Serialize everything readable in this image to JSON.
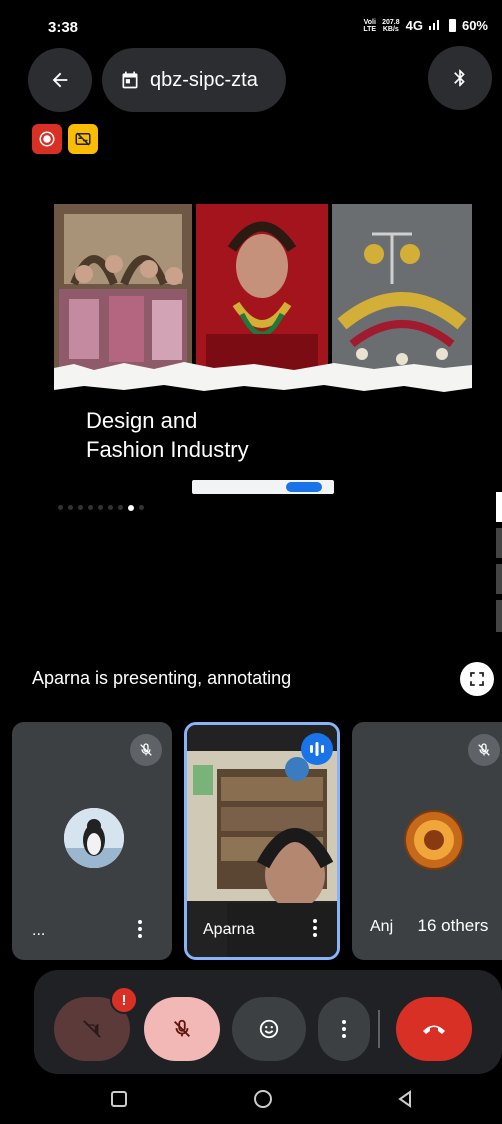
{
  "status_bar": {
    "time": "3:38",
    "network_label_top": "Voli",
    "network_label_bottom": "LTE",
    "speed_value": "207.8",
    "speed_unit": "KB/s",
    "network_type": "4G",
    "battery": "60%"
  },
  "header": {
    "meeting_code": "qbz-sipc-zta",
    "back_icon": "arrow-left-icon",
    "meeting_icon": "calendar-icon",
    "bluetooth_icon": "bluetooth-icon"
  },
  "indicators": {
    "recording_icon": "record-icon",
    "captions_icon": "captions-off-icon"
  },
  "slide": {
    "title_line1": "Design and",
    "title_line2": "Fashion Industry"
  },
  "presenting": {
    "text": "Aparna is presenting, annotating",
    "fullscreen_icon": "fullscreen-icon"
  },
  "tiles": [
    {
      "name": "...",
      "muted": true
    },
    {
      "name": "Aparna",
      "speaking": true
    },
    {
      "name": "Anj",
      "muted": true
    }
  ],
  "others_pill": "16 others",
  "controls": {
    "camera_icon": "camera-off-icon",
    "warning_badge": "!",
    "mic_icon": "mic-off-icon",
    "emoji_icon": "emoji-icon",
    "more_icon": "more-vert-icon",
    "end_call_icon": "call-end-icon"
  },
  "colors": {
    "background": "#000000",
    "chip": "#2b2d31",
    "tile": "#3c4043",
    "speaker_border": "#8ab4f8",
    "end_call": "#d93025",
    "mic_off": "#f2b8b5",
    "record": "#d93025",
    "captions": "#fbbc04"
  }
}
